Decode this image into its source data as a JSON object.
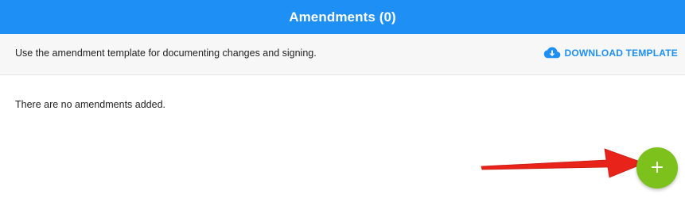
{
  "header": {
    "title": "Amendments (0)"
  },
  "info_bar": {
    "text": "Use the amendment template for documenting changes and signing.",
    "download_label": "DOWNLOAD TEMPLATE",
    "download_icon": "cloud-download-icon"
  },
  "content": {
    "empty_message": "There are no amendments added."
  },
  "fab": {
    "symbol": "+",
    "icon": "plus-icon"
  },
  "colors": {
    "header_bg": "#1e90f5",
    "accent": "#1e90f5",
    "fab_bg": "#7cc11c",
    "annotation_arrow": "#e8231a"
  }
}
